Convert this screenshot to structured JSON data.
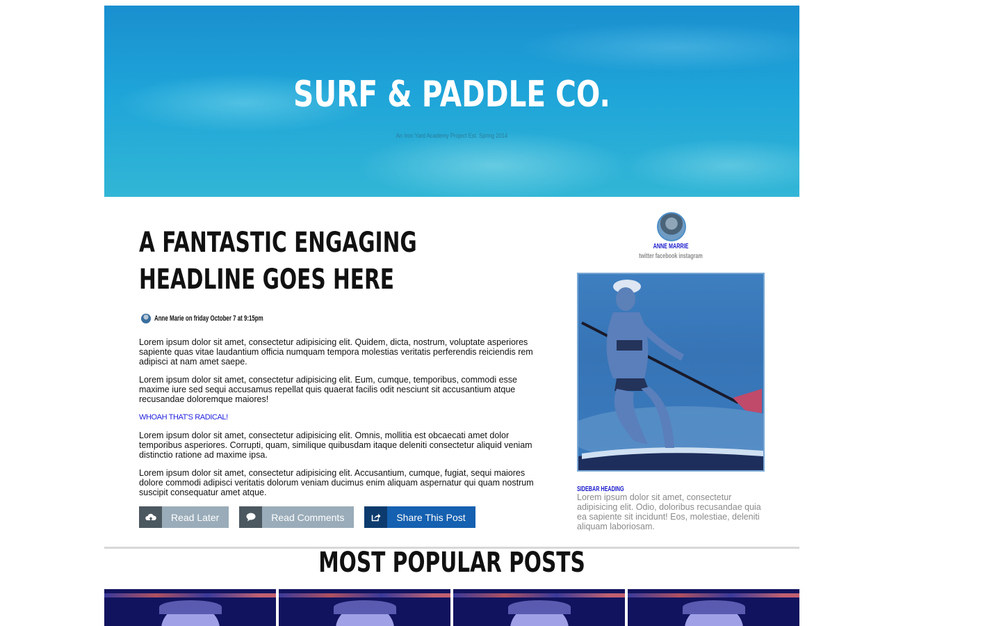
{
  "hero": {
    "title": "SURF & PADDLE CO.",
    "tagline": "An Iron Yard Academy Project Est. Spring 2014"
  },
  "article": {
    "headline": "A FANTASTIC ENGAGING HEADLINE GOES HERE",
    "byline": "Anne Marie on friday October 7 at 9:15pm",
    "paragraphs": [
      "Lorem ipsum dolor sit amet, consectetur adipisicing elit. Quidem, dicta, nostrum, voluptate asperiores sapiente quas vitae laudantium officia numquam tempora molestias veritatis perferendis reiciendis rem adipisci at nam amet saepe.",
      "Lorem ipsum dolor sit amet, consectetur adipisicing elit. Eum, cumque, temporibus, commodi esse maxime iure sed sequi accusamus repellat quis quaerat facilis odit nesciunt sit accusantium atque recusandae doloremque maiores!",
      "WHOAH THAT'S RADICAL!",
      "Lorem ipsum dolor sit amet, consectetur adipisicing elit. Omnis, mollitia est obcaecati amet dolor temporibus asperiores. Corrupti, quam, similique quibusdam itaque deleniti consectetur aliquid veniam distinctio ratione ad maxime ipsa.",
      "Lorem ipsum dolor sit amet, consectetur adipisicing elit. Accusantium, cumque, fugiat, sequi maiores dolore commodi adipisci veritatis dolorum veniam ducimus enim aliquam aspernatur qui quam nostrum suscipit consequatur amet atque."
    ],
    "buttons": [
      {
        "label": "Read Later",
        "icon": "cloud-upload-icon"
      },
      {
        "label": "Read Comments",
        "icon": "comment-icon"
      },
      {
        "label": "Share This Post",
        "icon": "share-icon"
      }
    ]
  },
  "sidebar": {
    "profile_name": "ANNE MARRIE",
    "social": "twitter facebook instagram",
    "heading": "SIDEBAR HEADING",
    "text": "Lorem ipsum dolor sit amet, consectetur adipisicing elit. Odio, doloribus recusandae quia ea sapiente sit incidunt! Eos, molestiae, deleniti aliquam laboriosam."
  },
  "popular": {
    "title": "MOST POPULAR POSTS"
  },
  "colors": {
    "link_blue": "#1a1acc",
    "button_gray": "#9aacb9",
    "button_blue": "#1560b0"
  }
}
